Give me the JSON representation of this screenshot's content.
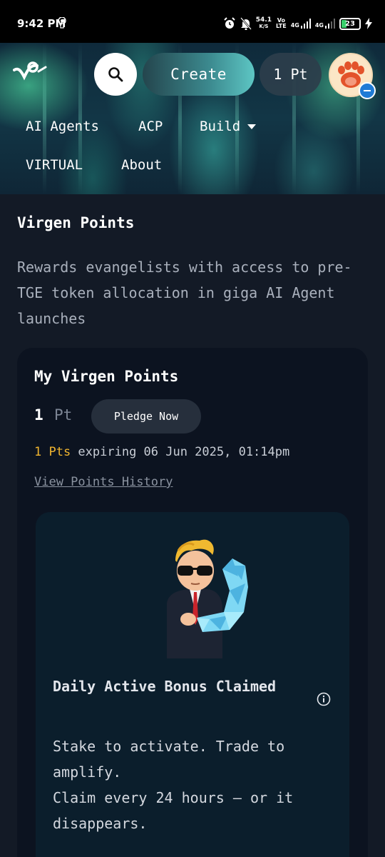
{
  "status_bar": {
    "time": "9:42 PM",
    "speed_value": "54.1",
    "speed_unit": "K/S",
    "network_1": "Vo\nLTE",
    "network_2": "4G",
    "network_3": "4G",
    "battery": "23"
  },
  "header": {
    "create_label": "Create",
    "points_label": "1 Pt",
    "nav": {
      "ai_agents": "AI Agents",
      "acp": "ACP",
      "build": "Build",
      "virtual": "VIRTUAL",
      "about": "About"
    }
  },
  "main": {
    "title": "Virgen Points",
    "description": "Rewards evangelists with access to pre-TGE token allocation in giga AI Agent launches"
  },
  "points_card": {
    "title": "My Virgen Points",
    "value": "1",
    "unit": "Pt",
    "pledge_label": "Pledge Now",
    "expiry_amount": "1 Pts",
    "expiry_text": " expiring 06 Jun 2025, 01:14pm",
    "history_link": "View Points History"
  },
  "bonus_card": {
    "title": "Daily Active Bonus Claimed",
    "description": "Stake to activate. Trade to amplify.\nClaim every 24 hours — or it disappears."
  },
  "colors": {
    "accent_yellow": "#f1b52f",
    "card_bg": "#0c1320",
    "page_bg": "#131a26"
  },
  "icons": [
    "hotspot-icon",
    "alarm-icon",
    "mute-icon",
    "signal-icon",
    "battery-icon",
    "charging-icon",
    "virtuals-logo-icon",
    "search-icon",
    "paw-icon",
    "chevron-down-icon",
    "info-icon"
  ]
}
